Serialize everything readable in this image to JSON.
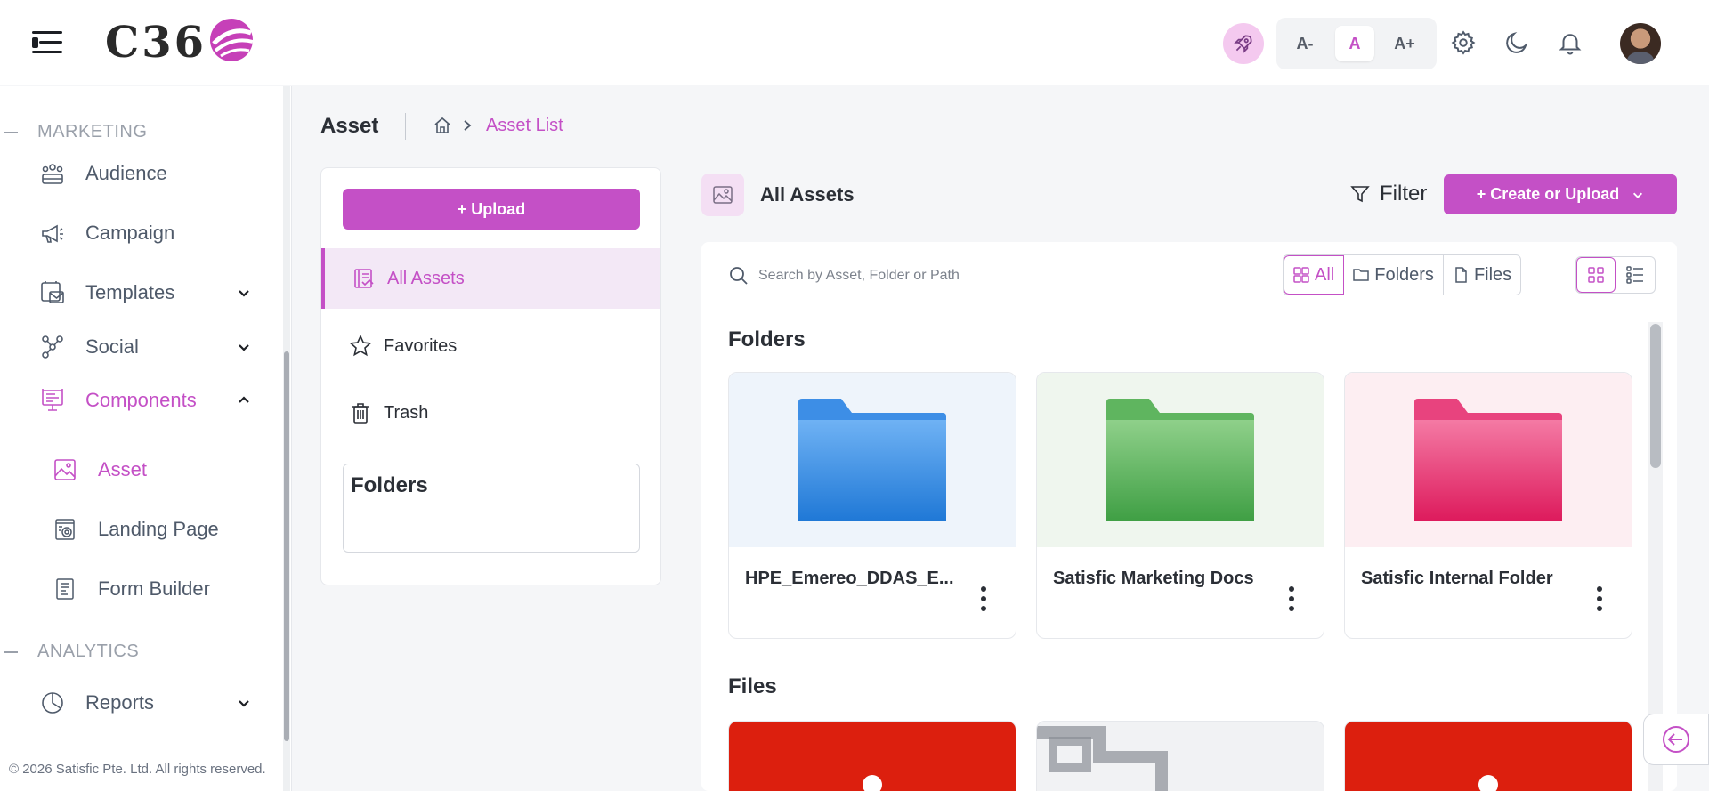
{
  "header": {
    "logo_text": "C36",
    "font_controls": [
      "A-",
      "A",
      "A+"
    ],
    "icons": [
      "hamburger-icon",
      "rocket-icon",
      "gear-icon",
      "moon-icon",
      "bell-icon",
      "avatar"
    ]
  },
  "sidebar": {
    "sections": [
      {
        "title": "MARKETING"
      },
      {
        "title": "ANALYTICS"
      }
    ],
    "items": [
      {
        "label": "Audience",
        "icon": "audience-icon"
      },
      {
        "label": "Campaign",
        "icon": "megaphone-icon"
      },
      {
        "label": "Templates",
        "icon": "template-icon"
      },
      {
        "label": "Social",
        "icon": "social-icon"
      },
      {
        "label": "Components",
        "icon": "components-icon"
      },
      {
        "label": "Asset",
        "icon": "image-icon"
      },
      {
        "label": "Landing Page",
        "icon": "landing-page-icon"
      },
      {
        "label": "Form Builder",
        "icon": "form-icon"
      },
      {
        "label": "Reports",
        "icon": "chart-pie-icon"
      }
    ],
    "copyright": "© 2026 Satisfic Pte. Ltd. All rights reserved."
  },
  "page": {
    "title": "Asset",
    "breadcrumb_current": "Asset List"
  },
  "left_panel": {
    "upload_label": "+ Upload",
    "nav": [
      {
        "label": "All Assets"
      },
      {
        "label": "Favorites"
      },
      {
        "label": "Trash"
      }
    ],
    "folders_title": "Folders"
  },
  "main": {
    "title": "All Assets",
    "filter_label": "Filter",
    "create_label": "+ Create or Upload",
    "search_placeholder": "Search by Asset, Folder or Path",
    "segments": [
      "All",
      "Folders",
      "Files"
    ],
    "folders_heading": "Folders",
    "files_heading": "Files",
    "folders": [
      {
        "name": "HPE_Emereo_DDAS_E...",
        "color": "#2f86e0"
      },
      {
        "name": "Satisfic Marketing Docs",
        "color": "#4fae50"
      },
      {
        "name": "Satisfic Internal Folder",
        "color": "#e83e7a"
      }
    ]
  },
  "colors": {
    "accent": "#c450c6"
  }
}
